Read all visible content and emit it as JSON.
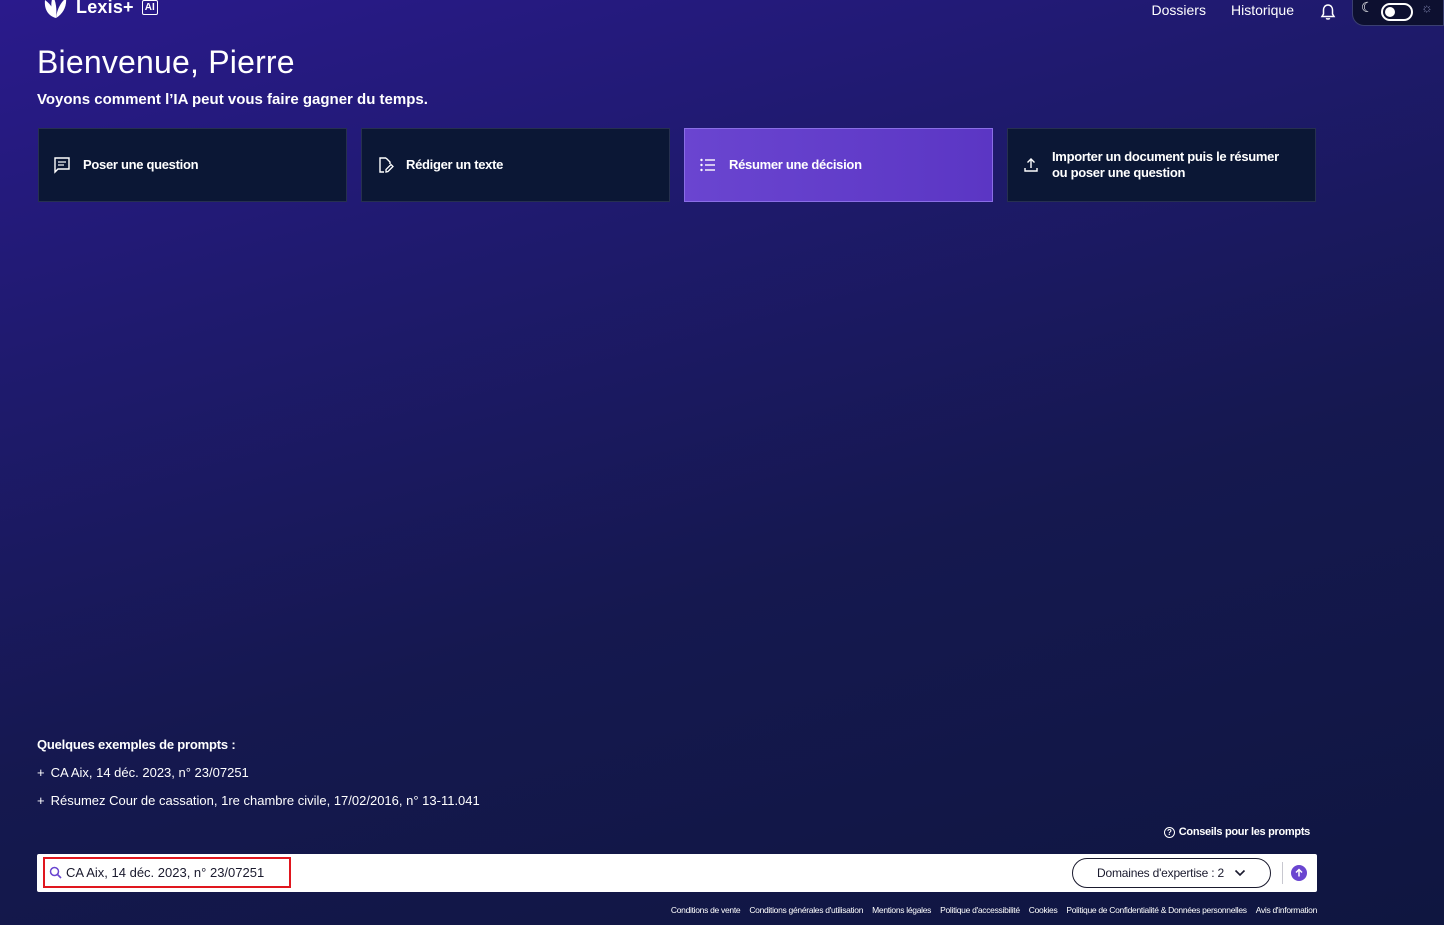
{
  "header": {
    "brand": "Lexis+",
    "brand_badge": "AI",
    "nav": [
      "Dossiers",
      "Historique"
    ]
  },
  "welcome": {
    "title": "Bienvenue, Pierre",
    "subtitle": "Voyons comment l’IA peut vous faire gagner du temps."
  },
  "cards": [
    {
      "label": "Poser une question",
      "icon": "chat-icon",
      "active": false
    },
    {
      "label": "Rédiger un texte",
      "icon": "edit-document-icon",
      "active": false
    },
    {
      "label": "Résumer une décision",
      "icon": "list-icon",
      "active": true
    },
    {
      "label": "Importer un document puis le résumer ou poser une question",
      "icon": "upload-icon",
      "active": false
    }
  ],
  "prompts": {
    "title": "Quelques exemples de prompts :",
    "items": [
      "CA Aix, 14 déc. 2023, n° 23/07251",
      "Résumez Cour de cassation, 1re chambre civile, 17/02/2016, n° 13-11.041"
    ],
    "prefix": "+"
  },
  "tips": {
    "label": "Conseils pour les prompts"
  },
  "search": {
    "value": "CA Aix, 14 déc. 2023, n° 23/07251",
    "domains_label": "Domaines d'expertise : 2"
  },
  "footer": {
    "links": [
      "Conditions de vente",
      "Conditions générales d'utilisation",
      "Mentions légales",
      "Politique d'accessibilité",
      "Cookies",
      "Politique de Confidentialité & Données personnelles",
      "Avis d'information"
    ]
  },
  "colors": {
    "accent": "#6a45d0",
    "card_bg": "#0b1735",
    "highlight": "#e0161e"
  }
}
